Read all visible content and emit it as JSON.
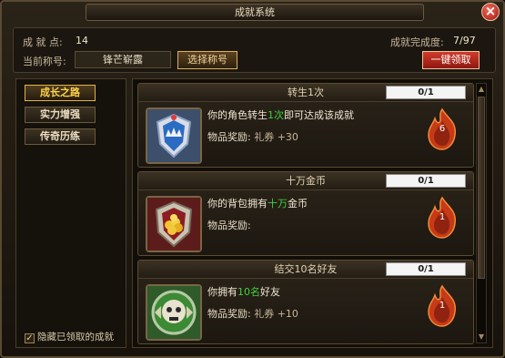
{
  "window": {
    "title": "成就系统"
  },
  "header": {
    "points_label": "成 就 点:",
    "points_value": "14",
    "completion_label": "成就完成度:",
    "completion_value": "7/97",
    "current_title_label": "当前称号:",
    "current_title_value": "锋芒崭露",
    "choose_title_button": "选择称号",
    "claim_all_button": "一键领取"
  },
  "sidebar": {
    "items": [
      {
        "label": "成长之路",
        "active": true
      },
      {
        "label": "实力增强",
        "active": false
      },
      {
        "label": "传奇历练",
        "active": false
      }
    ],
    "hide_claimed_label": "隐藏已领取的成就",
    "hide_claimed_checked": true
  },
  "achievements": [
    {
      "title": "转生1次",
      "progress": "0/1",
      "desc_pre": "你的角色转生",
      "desc_hl": "1次",
      "desc_post": "即可达成该成就",
      "reward_label": "物品奖励:",
      "reward_item": "礼券",
      "reward_qty": "+30",
      "flame_points": "6",
      "badge_icon": "crown-shield-badge"
    },
    {
      "title": "十万金币",
      "progress": "0/1",
      "desc_pre": "你的背包拥有",
      "desc_hl": "十万",
      "desc_post": "金币",
      "reward_label": "物品奖励:",
      "reward_item": "",
      "reward_qty": "",
      "flame_points": "1",
      "badge_icon": "gold-coins-badge"
    },
    {
      "title": "结交10名好友",
      "progress": "0/1",
      "desc_pre": "你拥有",
      "desc_hl": "10名",
      "desc_post": "好友",
      "reward_label": "物品奖励:",
      "reward_item": "礼券",
      "reward_qty": "+10",
      "flame_points": "1",
      "badge_icon": "friends-skull-badge"
    }
  ],
  "colors": {
    "accent_gold": "#ffd34a",
    "highlight_green": "#3fd23f",
    "claim_red": "#d23b2b"
  }
}
